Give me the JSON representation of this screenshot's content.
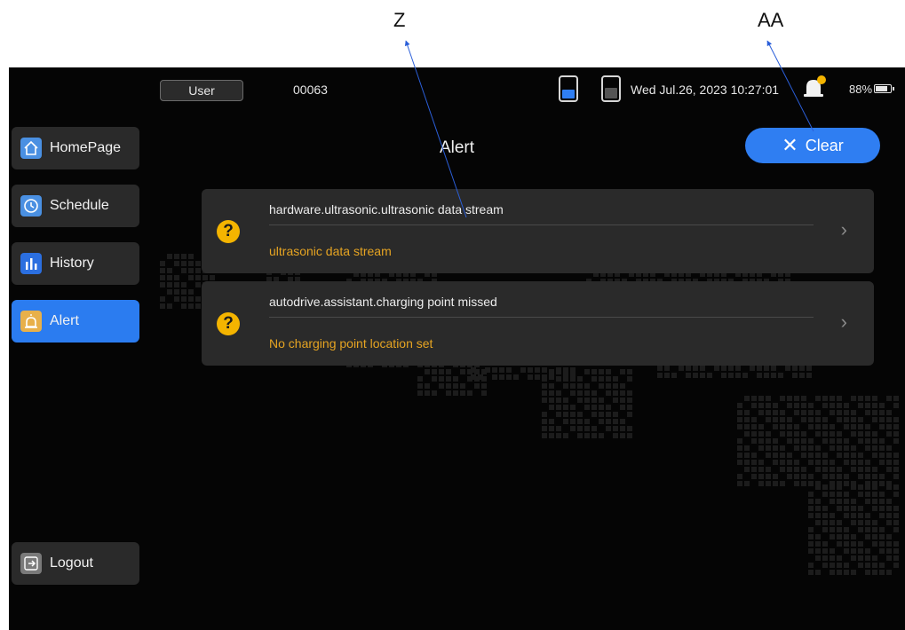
{
  "callouts": {
    "z": "Z",
    "aa": "AA"
  },
  "topbar": {
    "user_label": "User",
    "device_id": "00063",
    "datetime": "Wed Jul.26, 2023 10:27:01",
    "battery_percent_text": "88%",
    "battery_level": 0.88
  },
  "sidebar": {
    "items": [
      {
        "label": "HomePage",
        "icon": "home-icon",
        "color": "#4a90e2"
      },
      {
        "label": "Schedule",
        "icon": "clock-icon",
        "color": "#4a90e2"
      },
      {
        "label": "History",
        "icon": "bar-chart-icon",
        "color": "#2b6fe0"
      },
      {
        "label": "Alert",
        "icon": "alarm-icon",
        "color": "#e8b04a"
      }
    ],
    "logout": {
      "label": "Logout",
      "icon": "logout-icon"
    }
  },
  "main": {
    "title": "Alert",
    "clear_label": "Clear",
    "alerts": [
      {
        "title": "hardware.ultrasonic.ultrasonic data stream",
        "description": "ultrasonic data stream"
      },
      {
        "title": "autodrive.assistant.charging point missed",
        "description": "No charging point location set"
      }
    ]
  },
  "colors": {
    "accent": "#2f7ef2",
    "warning": "#e6a422",
    "background": "#050505"
  }
}
